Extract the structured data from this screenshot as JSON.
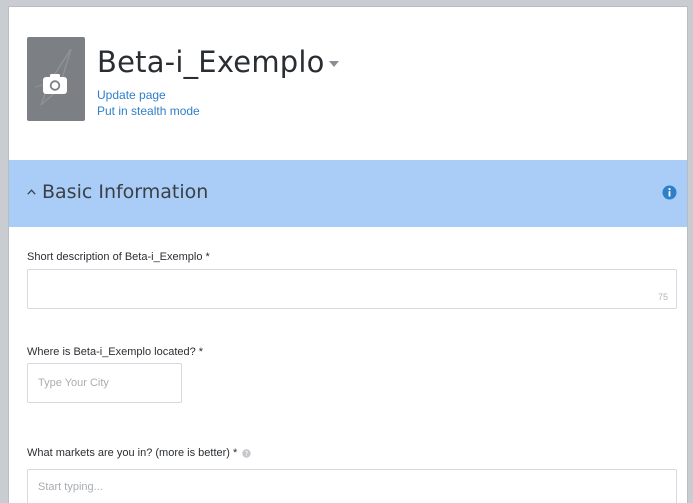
{
  "header": {
    "title": "Beta-i_Exemplo",
    "update_link": "Update page",
    "stealth_link": "Put in stealth mode"
  },
  "section": {
    "title": "Basic Information",
    "accent": "#a9cdf7"
  },
  "form": {
    "description_label": "Short description of Beta-i_Exemplo *",
    "description_counter": "75",
    "location_label": "Where is Beta-i_Exemplo located? *",
    "location_placeholder": "Type Your City",
    "markets_label": "What markets are you in? (more is better) *",
    "markets_placeholder": "Start typing..."
  },
  "icons": {
    "avatar": "camera-icon",
    "title_menu": "caret-down-icon",
    "section_toggle": "chevron-up-icon",
    "section_info": "info-icon",
    "markets_help": "help-icon"
  },
  "colors": {
    "link": "#2f7fc8",
    "info": "#2f7fc8"
  }
}
